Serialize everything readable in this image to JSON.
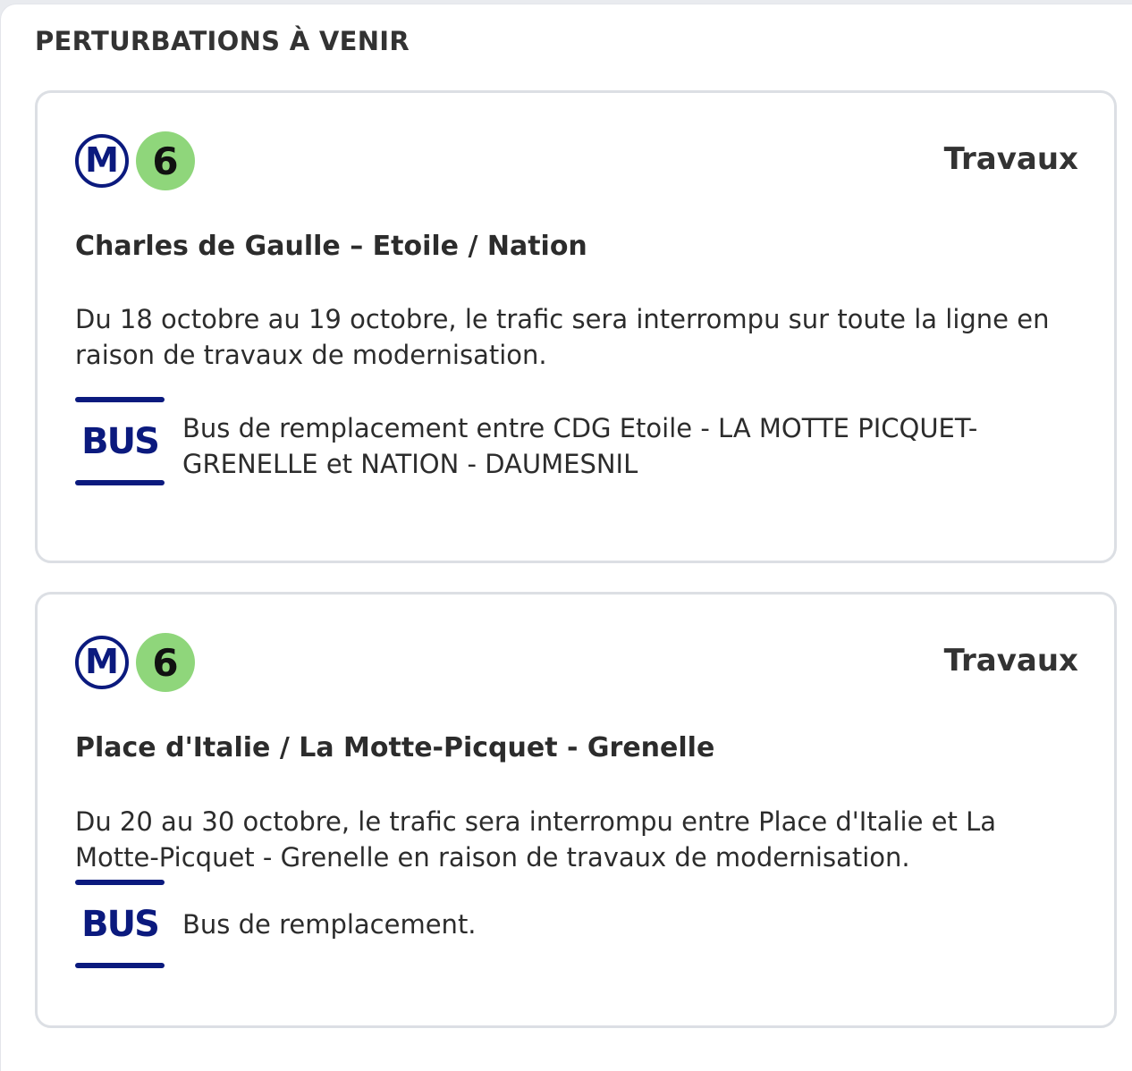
{
  "section_title": "PERTURBATIONS À VENIR",
  "colors": {
    "metro_blue": "#0b1a7e",
    "line_6_green": "#8fd67b",
    "card_border": "#dcdfe4"
  },
  "disruptions": [
    {
      "mode_icon": "metro-icon",
      "mode_letter": "M",
      "line": "6",
      "category": "Travaux",
      "route": "Charles de Gaulle – Etoile / Nation",
      "description": "Du 18 octobre au 19 octobre, le trafic sera interrompu sur toute la ligne en raison de travaux de modernisation.",
      "replacement": {
        "icon": "bus-icon",
        "icon_text": "BUS",
        "text": "Bus de remplacement entre CDG Etoile - LA MOTTE PICQUET-GRENELLE et NATION - DAUMESNIL"
      }
    },
    {
      "mode_icon": "metro-icon",
      "mode_letter": "M",
      "line": "6",
      "category": "Travaux",
      "route": "Place d'Italie / La Motte-Picquet - Grenelle",
      "description": "Du 20 au 30 octobre, le trafic sera interrompu entre Place d'Italie et La Motte-Picquet - Grenelle en raison de travaux de modernisation.",
      "replacement": {
        "icon": "bus-icon",
        "icon_text": "BUS",
        "text": "Bus de remplacement."
      }
    }
  ]
}
